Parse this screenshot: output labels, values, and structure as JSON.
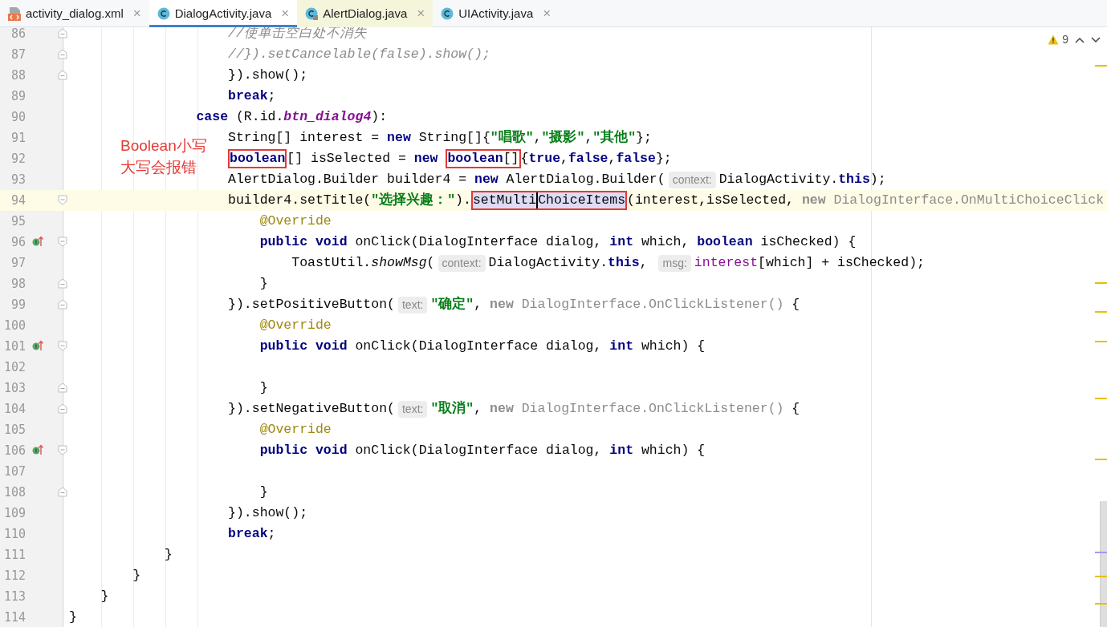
{
  "tabs": [
    {
      "label": "activity_dialog.xml",
      "kind": "xml",
      "selected": false,
      "read_only": false,
      "close": "×"
    },
    {
      "label": "DialogActivity.java",
      "kind": "class",
      "selected": true,
      "read_only": false,
      "close": "×"
    },
    {
      "label": "AlertDialog.java",
      "kind": "locked",
      "selected": false,
      "read_only": true,
      "close": "×"
    },
    {
      "label": "UIActivity.java",
      "kind": "class",
      "selected": false,
      "read_only": false,
      "close": "×"
    }
  ],
  "inspection": {
    "warnings": "9"
  },
  "callout": {
    "lines": [
      "Boolean小写",
      "大写会报错"
    ]
  },
  "lines": [
    {
      "number": "86",
      "fold_start": false,
      "fold_end": true,
      "override": false,
      "current": false,
      "tokens": [
        {
          "kind": "comment",
          "text": "                    //使单击空白处不消失"
        }
      ]
    },
    {
      "number": "87",
      "fold_start": false,
      "fold_end": true,
      "override": false,
      "current": false,
      "tokens": [
        {
          "kind": "comment",
          "text": "                    //}).setCancelable(false).show();"
        }
      ]
    },
    {
      "number": "88",
      "fold_start": false,
      "fold_end": true,
      "override": false,
      "current": false,
      "tokens": [
        {
          "kind": "plain",
          "text": "                    }).show();"
        }
      ]
    },
    {
      "number": "89",
      "fold_start": false,
      "fold_end": false,
      "override": false,
      "current": false,
      "tokens": [
        {
          "kind": "keyword",
          "text": "                    break"
        },
        {
          "kind": "plain",
          "text": ";"
        }
      ]
    },
    {
      "number": "90",
      "fold_start": false,
      "fold_end": false,
      "override": false,
      "current": false,
      "tokens": [
        {
          "kind": "keyword",
          "text": "                case"
        },
        {
          "kind": "plain",
          "text": " (R.id."
        },
        {
          "kind": "constant",
          "text": "btn_dialog4"
        },
        {
          "kind": "plain",
          "text": "):"
        }
      ]
    },
    {
      "number": "91",
      "fold_start": false,
      "fold_end": false,
      "override": false,
      "current": false,
      "tokens": [
        {
          "kind": "plain",
          "text": "                    String[] interest = "
        },
        {
          "kind": "keyword",
          "text": "new"
        },
        {
          "kind": "plain",
          "text": " String[]{"
        },
        {
          "kind": "string",
          "text": "\"唱歌\""
        },
        {
          "kind": "plain",
          "text": ","
        },
        {
          "kind": "string",
          "text": "\"摄影\""
        },
        {
          "kind": "plain",
          "text": ","
        },
        {
          "kind": "string",
          "text": "\"其他\""
        },
        {
          "kind": "plain",
          "text": "};"
        }
      ]
    },
    {
      "number": "92",
      "fold_start": false,
      "fold_end": false,
      "override": false,
      "current": false,
      "tokens": [
        {
          "kind": "box",
          "selected": false,
          "children": [
            {
              "kind": "keyword",
              "text": "                    boolean"
            }
          ]
        },
        {
          "kind": "plain",
          "text": "[] isSelected = "
        },
        {
          "kind": "keyword",
          "text": "new "
        },
        {
          "kind": "box",
          "selected": false,
          "children": [
            {
              "kind": "keyword",
              "text": "boolean"
            },
            {
              "kind": "plain",
              "text": "[]"
            }
          ]
        },
        {
          "kind": "plain",
          "text": "{"
        },
        {
          "kind": "keyword",
          "text": "true"
        },
        {
          "kind": "plain",
          "text": ","
        },
        {
          "kind": "keyword",
          "text": "false"
        },
        {
          "kind": "plain",
          "text": ","
        },
        {
          "kind": "keyword",
          "text": "false"
        },
        {
          "kind": "plain",
          "text": "};"
        }
      ]
    },
    {
      "number": "93",
      "fold_start": false,
      "fold_end": false,
      "override": false,
      "current": false,
      "tokens": [
        {
          "kind": "plain",
          "text": "                    AlertDialog.Builder builder4 = "
        },
        {
          "kind": "keyword",
          "text": "new"
        },
        {
          "kind": "plain",
          "text": " AlertDialog.Builder("
        },
        {
          "kind": "hint",
          "text": "context:"
        },
        {
          "kind": "plain",
          "text": "DialogActivity."
        },
        {
          "kind": "keyword",
          "text": "this"
        },
        {
          "kind": "plain",
          "text": ");"
        }
      ]
    },
    {
      "number": "94",
      "fold_start": true,
      "fold_end": false,
      "override": false,
      "current": true,
      "tokens": [
        {
          "kind": "plain",
          "text": "                    builder4.setTitle("
        },
        {
          "kind": "string",
          "text": "\"选择兴趣：\""
        },
        {
          "kind": "plain",
          "text": ")."
        },
        {
          "kind": "box",
          "selected": true,
          "children": [
            {
              "kind": "plain",
              "text": "setMulti"
            },
            {
              "kind": "caret"
            },
            {
              "kind": "plain",
              "text": "ChoiceItems"
            }
          ]
        },
        {
          "kind": "plain",
          "text": "(interest,isSelected, "
        },
        {
          "kind": "dim_keyword",
          "text": "new"
        },
        {
          "kind": "dim",
          "text": " DialogInterface.OnMultiChoiceClick"
        }
      ]
    },
    {
      "number": "95",
      "fold_start": false,
      "fold_end": false,
      "override": false,
      "current": false,
      "tokens": [
        {
          "kind": "annotation",
          "text": "                        @Override"
        }
      ]
    },
    {
      "number": "96",
      "fold_start": true,
      "fold_end": false,
      "override": true,
      "current": false,
      "tokens": [
        {
          "kind": "keyword",
          "text": "                        public void"
        },
        {
          "kind": "plain",
          "text": " onClick(DialogInterface dialog, "
        },
        {
          "kind": "keyword",
          "text": "int"
        },
        {
          "kind": "plain",
          "text": " which, "
        },
        {
          "kind": "keyword",
          "text": "boolean"
        },
        {
          "kind": "plain",
          "text": " isChecked) {"
        }
      ]
    },
    {
      "number": "97",
      "fold_start": false,
      "fold_end": false,
      "override": false,
      "current": false,
      "tokens": [
        {
          "kind": "plain",
          "text": "                            ToastUtil."
        },
        {
          "kind": "static",
          "text": "showMsg"
        },
        {
          "kind": "plain",
          "text": "("
        },
        {
          "kind": "hint",
          "text": "context:"
        },
        {
          "kind": "plain",
          "text": "DialogActivity."
        },
        {
          "kind": "keyword",
          "text": "this"
        },
        {
          "kind": "plain",
          "text": ", "
        },
        {
          "kind": "hint",
          "text": "msg:"
        },
        {
          "kind": "variable",
          "text": "interest"
        },
        {
          "kind": "plain",
          "text": "[which] + isChecked);"
        }
      ]
    },
    {
      "number": "98",
      "fold_start": false,
      "fold_end": true,
      "override": false,
      "current": false,
      "tokens": [
        {
          "kind": "plain",
          "text": "                        }"
        }
      ]
    },
    {
      "number": "99",
      "fold_start": false,
      "fold_end": true,
      "override": false,
      "current": false,
      "tokens": [
        {
          "kind": "plain",
          "text": "                    }).setPositiveButton("
        },
        {
          "kind": "hint",
          "text": "text:"
        },
        {
          "kind": "string",
          "text": "\"确定\""
        },
        {
          "kind": "plain",
          "text": ", "
        },
        {
          "kind": "dim_keyword",
          "text": "new"
        },
        {
          "kind": "dim",
          "text": " DialogInterface.OnClickListener()"
        },
        {
          "kind": "plain",
          "text": " {"
        }
      ]
    },
    {
      "number": "100",
      "fold_start": false,
      "fold_end": false,
      "override": false,
      "current": false,
      "tokens": [
        {
          "kind": "annotation",
          "text": "                        @Override"
        }
      ]
    },
    {
      "number": "101",
      "fold_start": true,
      "fold_end": false,
      "override": true,
      "current": false,
      "tokens": [
        {
          "kind": "keyword",
          "text": "                        public void"
        },
        {
          "kind": "plain",
          "text": " onClick(DialogInterface dialog, "
        },
        {
          "kind": "keyword",
          "text": "int"
        },
        {
          "kind": "plain",
          "text": " which) {"
        }
      ]
    },
    {
      "number": "102",
      "fold_start": false,
      "fold_end": false,
      "override": false,
      "current": false
    },
    {
      "number": "103",
      "fold_start": false,
      "fold_end": true,
      "override": false,
      "current": false,
      "tokens": [
        {
          "kind": "plain",
          "text": "                        }"
        }
      ]
    },
    {
      "number": "104",
      "fold_start": false,
      "fold_end": true,
      "override": false,
      "current": false,
      "tokens": [
        {
          "kind": "plain",
          "text": "                    }).setNegativeButton("
        },
        {
          "kind": "hint",
          "text": "text:"
        },
        {
          "kind": "string",
          "text": "\"取消\""
        },
        {
          "kind": "plain",
          "text": ", "
        },
        {
          "kind": "dim_keyword",
          "text": "new"
        },
        {
          "kind": "dim",
          "text": " DialogInterface.OnClickListener()"
        },
        {
          "kind": "plain",
          "text": " {"
        }
      ]
    },
    {
      "number": "105",
      "fold_start": false,
      "fold_end": false,
      "override": false,
      "current": false,
      "tokens": [
        {
          "kind": "annotation",
          "text": "                        @Override"
        }
      ]
    },
    {
      "number": "106",
      "fold_start": true,
      "fold_end": false,
      "override": true,
      "current": false,
      "tokens": [
        {
          "kind": "keyword",
          "text": "                        public void"
        },
        {
          "kind": "plain",
          "text": " onClick(DialogInterface dialog, "
        },
        {
          "kind": "keyword",
          "text": "int"
        },
        {
          "kind": "plain",
          "text": " which) {"
        }
      ]
    },
    {
      "number": "107",
      "fold_start": false,
      "fold_end": false,
      "override": false,
      "current": false
    },
    {
      "number": "108",
      "fold_start": false,
      "fold_end": true,
      "override": false,
      "current": false,
      "tokens": [
        {
          "kind": "plain",
          "text": "                        }"
        }
      ]
    },
    {
      "number": "109",
      "fold_start": false,
      "fold_end": false,
      "override": false,
      "current": false,
      "tokens": [
        {
          "kind": "plain",
          "text": "                    }).show();"
        }
      ]
    },
    {
      "number": "110",
      "fold_start": false,
      "fold_end": false,
      "override": false,
      "current": false,
      "tokens": [
        {
          "kind": "keyword",
          "text": "                    break"
        },
        {
          "kind": "plain",
          "text": ";"
        }
      ]
    },
    {
      "number": "111",
      "fold_start": false,
      "fold_end": false,
      "override": false,
      "current": false,
      "tokens": [
        {
          "kind": "plain",
          "text": "            }"
        }
      ]
    },
    {
      "number": "112",
      "fold_start": false,
      "fold_end": false,
      "override": false,
      "current": false,
      "tokens": [
        {
          "kind": "plain",
          "text": "        }"
        }
      ]
    },
    {
      "number": "113",
      "fold_start": false,
      "fold_end": false,
      "override": false,
      "current": false,
      "tokens": [
        {
          "kind": "plain",
          "text": "    }"
        }
      ]
    },
    {
      "number": "114",
      "fold_start": false,
      "fold_end": false,
      "override": false,
      "current": false,
      "tokens": [
        {
          "kind": "plain",
          "text": "}"
        }
      ]
    }
  ]
}
